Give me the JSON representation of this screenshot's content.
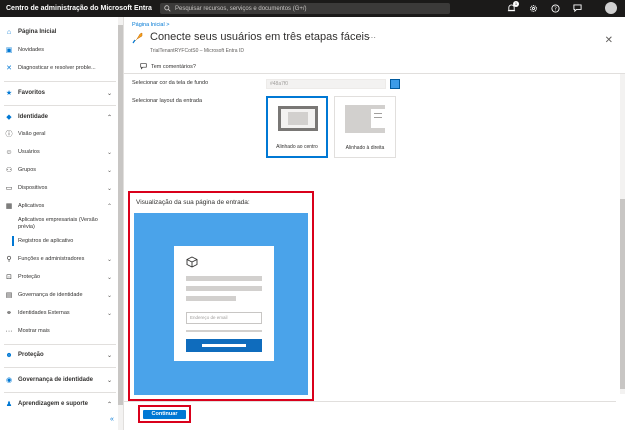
{
  "topbar": {
    "title": "Centro de administração do Microsoft Entra",
    "search_placeholder": "Pesquisar recursos, serviços e documentos (G+/)",
    "notification_count": "1",
    "icons": [
      "bell-icon",
      "gear-icon",
      "help-icon",
      "feedback-icon"
    ]
  },
  "sidebar": {
    "items": [
      {
        "label": "Página Inicial",
        "icon": "home-icon"
      },
      {
        "label": "Novidades",
        "icon": "whats-new-icon"
      },
      {
        "label": "Diagnosticar e resolver proble...",
        "icon": "diagnose-icon"
      },
      {
        "label": "Favoritos",
        "icon": "star-icon"
      },
      {
        "label": "Identidade",
        "icon": "diamond-icon"
      },
      {
        "label": "Visão geral",
        "icon": "info-icon"
      },
      {
        "label": "Usuários",
        "icon": "user-icon"
      },
      {
        "label": "Grupos",
        "icon": "group-icon"
      },
      {
        "label": "Dispositivos",
        "icon": "devices-icon"
      },
      {
        "label": "Aplicativos",
        "icon": "apps-icon"
      },
      {
        "label": "Aplicativos empresariais (Versão prévia)",
        "icon": ""
      },
      {
        "label": "Registros de aplicativo",
        "icon": ""
      },
      {
        "label": "Funções e administradores",
        "icon": "roles-icon"
      },
      {
        "label": "Proteção",
        "icon": "lock-icon"
      },
      {
        "label": "Governança de identidade",
        "icon": "governance-icon"
      },
      {
        "label": "Identidades Externas",
        "icon": "external-icon"
      },
      {
        "label": "Mostrar mais",
        "icon": "more-icon"
      },
      {
        "label": "Proteção",
        "icon": "protection-icon"
      },
      {
        "label": "Governança de identidade",
        "icon": "governance-icon"
      },
      {
        "label": "Aprendizagem e suporte",
        "icon": "learning-icon"
      }
    ],
    "collapse_label": "«"
  },
  "main": {
    "breadcrumb": "Página Inicial  >",
    "title": "Conecte seus usuários em três etapas fáceis",
    "ellipsis": "···",
    "subtitle": "TrialTenantRYFCotS0 – Microsoft Entra ID",
    "feedback": "Tem comentários?",
    "bg_color_label": "Selecionar cor da tela de fundo",
    "bg_color_value": "#48a7f0",
    "layout_label": "Selecionar layout da entrada",
    "layouts": [
      {
        "label": "Alinhado ao centro",
        "selected": true
      },
      {
        "label": "Alinhado à direita",
        "selected": false
      }
    ],
    "preview_title": "Visualização da sua página de entrada:",
    "email_placeholder": "Endereço de email",
    "continue_label": "Continuar"
  }
}
